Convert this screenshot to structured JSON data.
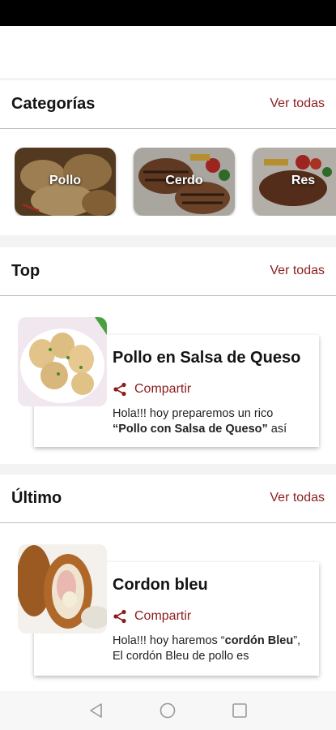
{
  "categories_section": {
    "title": "Categorías",
    "see_all": "Ver todas"
  },
  "categories": [
    {
      "label": "Pollo"
    },
    {
      "label": "Cerdo"
    },
    {
      "label": "Res"
    }
  ],
  "top_section": {
    "title": "Top",
    "see_all": "Ver todas"
  },
  "top_recipe": {
    "title": "Pollo en Salsa de Queso",
    "share_label": "Compartir",
    "desc_line1": "Hola!!! hoy preparemos un rico",
    "desc_bold": "“Pollo con Salsa de Queso”",
    "desc_tail": " así"
  },
  "latest_section": {
    "title": "Último",
    "see_all": "Ver todas"
  },
  "latest_recipe": {
    "title": "Cordon bleu",
    "share_label": "Compartir",
    "desc_pre": "Hola!!! hoy haremos “",
    "desc_bold1": "cordón Bleu",
    "desc_mid": "”, El cordón Bleu de pollo  es"
  },
  "nav": {
    "back": "back-triangle-icon",
    "home": "home-circle-icon",
    "recents": "recents-square-icon"
  },
  "colors": {
    "accent": "#8c1d1d",
    "divider": "#bdbdbd",
    "background": "#f3f3f3"
  }
}
